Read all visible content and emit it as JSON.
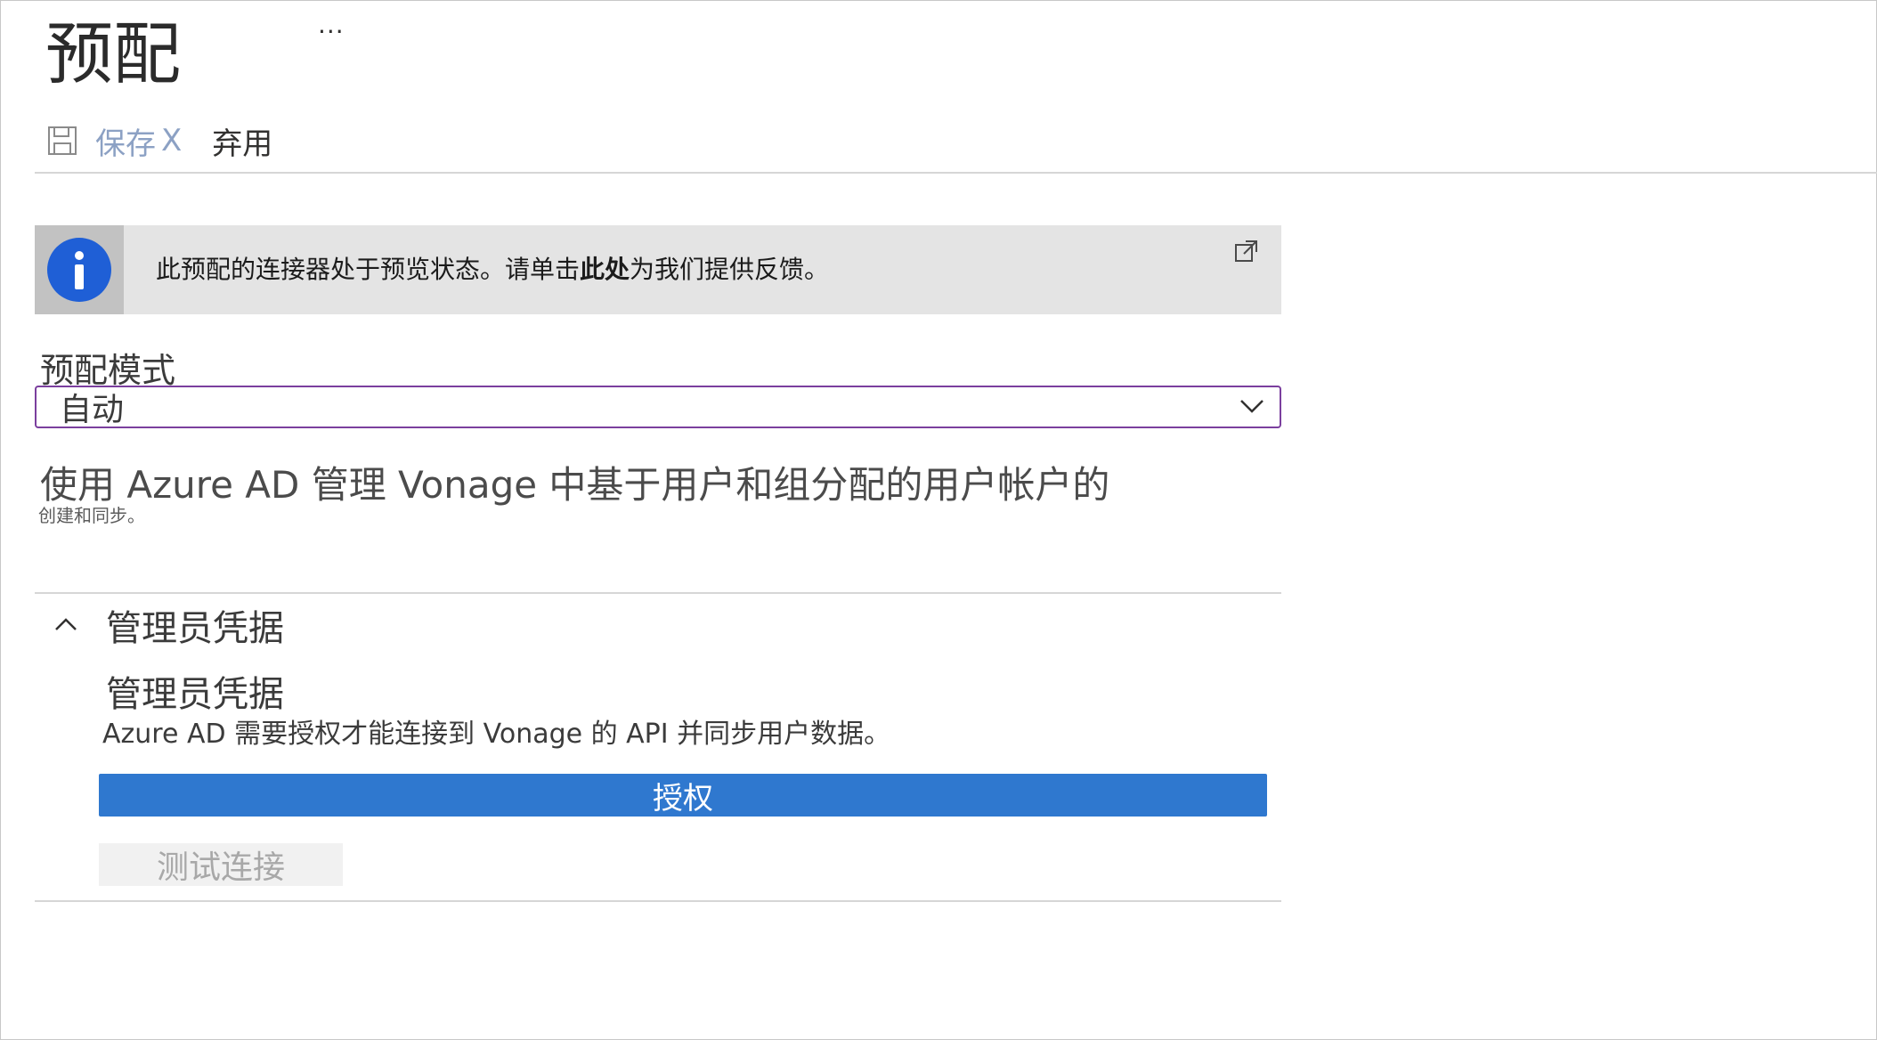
{
  "header": {
    "title": "预配",
    "more_label": "···"
  },
  "toolbar": {
    "save_label": "保存",
    "discard_x": "X",
    "discard_label": "弃用"
  },
  "info_banner": {
    "text_before_link": "此预配的连接器处于预览状态。请单击",
    "link_text": "此处",
    "text_after_link": "为我们提供反馈。"
  },
  "provisioning": {
    "mode_label": "预配模式",
    "mode_value": "自动",
    "description_line1": "使用 Azure AD 管理 Vonage 中基于用户和组分配的用户帐户的",
    "description_line2": "创建和同步。"
  },
  "admin_credentials": {
    "section_header": "管理员凭据",
    "title": "管理员凭据",
    "description": "Azure AD 需要授权才能连接到 Vonage 的 API 并同步用户数据。",
    "authorize_label": "授权",
    "test_connection_label": "测试连接"
  },
  "colors": {
    "accent_blue": "#2f78cf",
    "info_blue": "#1f5fd6",
    "select_border": "#7b3f9e",
    "save_text": "#8ca1c4"
  },
  "icons": {
    "save": "save-icon",
    "info": "info-icon",
    "external_link": "external-link-icon",
    "dropdown": "chevron-down-icon",
    "collapse": "chevron-up-icon"
  }
}
